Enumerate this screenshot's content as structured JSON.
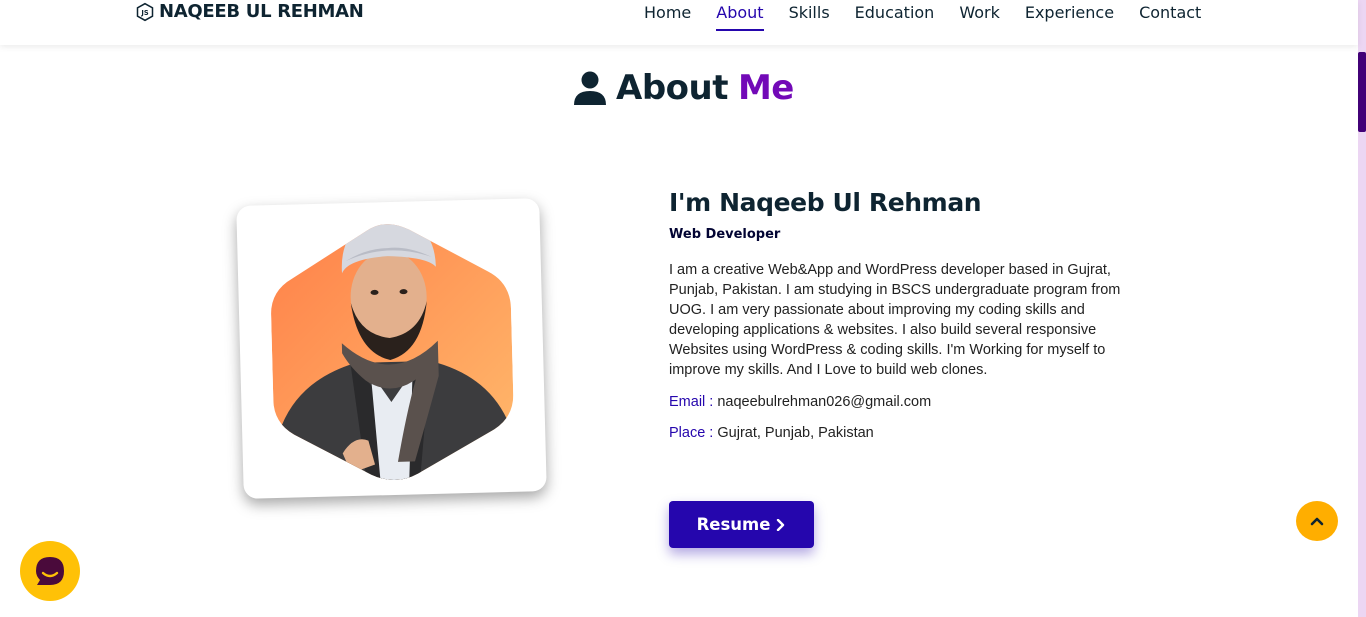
{
  "brand": {
    "name": "NAQEEB UL REHMAN",
    "icon": "js-badge-icon"
  },
  "nav": {
    "items": [
      {
        "label": "Home",
        "active": false
      },
      {
        "label": "About",
        "active": true
      },
      {
        "label": "Skills",
        "active": false
      },
      {
        "label": "Education",
        "active": false
      },
      {
        "label": "Work",
        "active": false
      },
      {
        "label": "Experience",
        "active": false
      },
      {
        "label": "Contact",
        "active": false
      }
    ]
  },
  "section": {
    "icon": "user-icon",
    "title_main": "About",
    "title_accent": "Me"
  },
  "about": {
    "name": "I'm Naqeeb Ul Rehman",
    "role": "Web Developer",
    "bio": "I am a creative Web&App and WordPress developer based in Gujrat, Punjab, Pakistan. I am studying in BSCS undergraduate program from UOG. I am very passionate about improving my coding skills and developing applications & websites. I also build several responsive Websites using WordPress & coding skills. I'm Working for myself to improve my skills. And I Love to build web clones.",
    "email_label": "Email :",
    "email_value": "naqeebulrehman026@gmail.com",
    "place_label": "Place :",
    "place_value": "Gujrat, Punjab, Pakistan",
    "resume_label": "Resume"
  },
  "colors": {
    "accent": "#7209b7",
    "primary": "#2506ad",
    "chat": "#ffc107",
    "scroll_top": "#ffae00"
  }
}
